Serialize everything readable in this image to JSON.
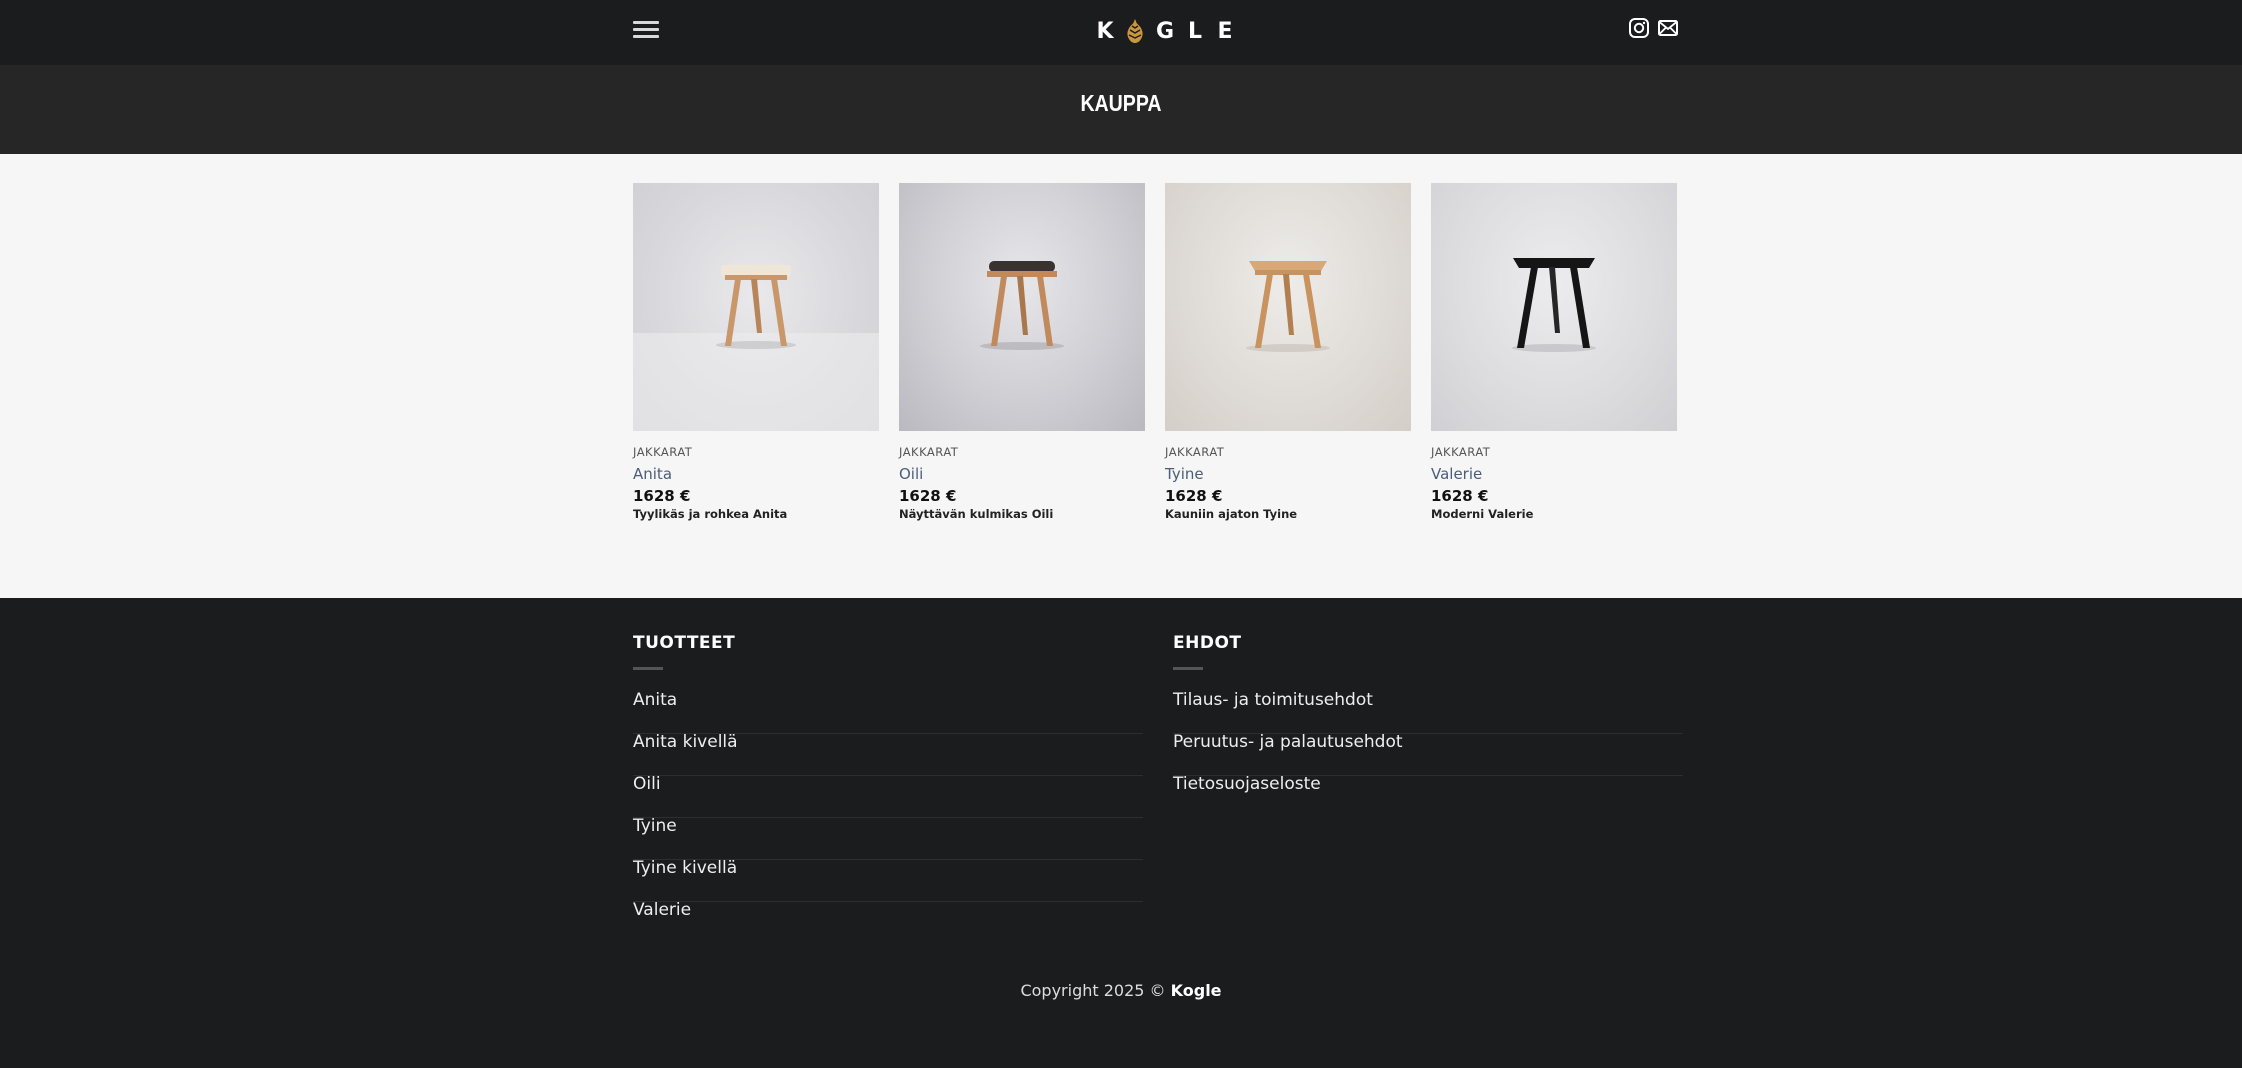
{
  "header": {
    "logo_letters": [
      "K",
      "G",
      "L",
      "E"
    ],
    "page_title": "KAUPPA"
  },
  "products": [
    {
      "category": "JAKKARAT",
      "name": "Anita",
      "price": "1628 €",
      "description": "Tyylikäs ja rohkea Anita",
      "seat_color": "#efe6d8",
      "wood_color": "#c9976a"
    },
    {
      "category": "JAKKARAT",
      "name": "Oili",
      "price": "1628 €",
      "description": "Näyttävän kulmikas Oili",
      "seat_color": "#3a3131",
      "wood_color": "#c08a5c"
    },
    {
      "category": "JAKKARAT",
      "name": "Tyine",
      "price": "1628 €",
      "description": "Kauniin ajaton Tyine",
      "seat_color": "#d9a877",
      "wood_color": "#c8935f"
    },
    {
      "category": "JAKKARAT",
      "name": "Valerie",
      "price": "1628 €",
      "description": "Moderni Valerie",
      "seat_color": "#151515",
      "wood_color": "#151515"
    }
  ],
  "footer": {
    "products_heading": "TUOTTEET",
    "products_links": [
      "Anita",
      "Anita kivellä",
      "Oili",
      "Tyine",
      "Tyine kivellä",
      "Valerie"
    ],
    "terms_heading": "EHDOT",
    "terms_links": [
      "Tilaus- ja toimitusehdot",
      "Peruutus- ja palautusehdot",
      "Tietosuojaseloste"
    ],
    "copyright_prefix": "Copyright 2025 © ",
    "copyright_brand": "Kogle"
  },
  "icons": {
    "menu": "hamburger-icon",
    "instagram": "instagram-icon",
    "mail": "mail-icon",
    "logo_mark": "pinecone-icon"
  },
  "colors": {
    "header_bg": "#1b1c1e",
    "title_bg": "#262626",
    "link": "#4b5d78",
    "logo_accent": "#c9973c"
  }
}
